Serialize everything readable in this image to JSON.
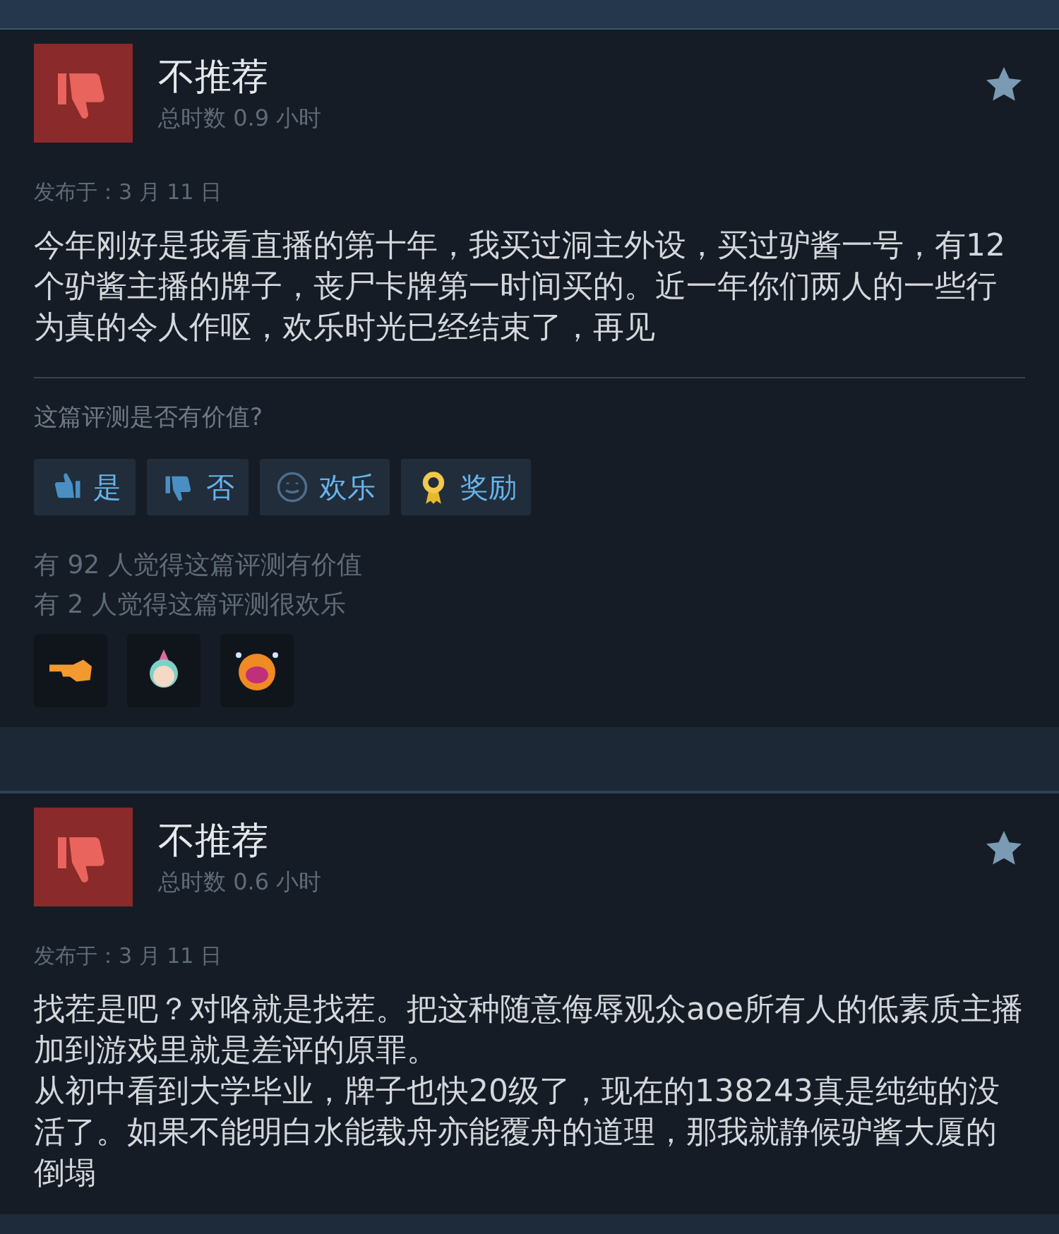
{
  "reviews": [
    {
      "verdict": "不推荐",
      "hours": "总时数 0.9 小时",
      "posted": "发布于：3 月 11 日",
      "paragraphs": [
        "今年刚好是我看直播的第十年，我买过洞主外设，买过驴酱一号，有12个驴酱主播的牌子，丧尸卡牌第一时间买的。近一年你们两人的一些行为真的令人作呕，欢乐时光已经结束了，再见"
      ],
      "helpful_prompt": "这篇评测是否有价值?",
      "buttons": [
        {
          "kind": "yes",
          "label": "是"
        },
        {
          "kind": "no",
          "label": "否"
        },
        {
          "kind": "funny",
          "label": "欢乐"
        },
        {
          "kind": "award",
          "label": "奖励"
        }
      ],
      "counts": [
        "有 92 人觉得这篇评测有价值",
        "有 2 人觉得这篇评测很欢乐"
      ],
      "awards": [
        {
          "kind": "hand"
        },
        {
          "kind": "figure"
        },
        {
          "kind": "laugh"
        }
      ]
    },
    {
      "verdict": "不推荐",
      "hours": "总时数 0.6 小时",
      "posted": "发布于：3 月 11 日",
      "paragraphs": [
        "找茬是吧？对咯就是找茬。把这种随意侮辱观众aoe所有人的低素质主播加到游戏里就是差评的原罪。",
        "从初中看到大学毕业，牌子也快20级了，现在的138243真是纯纯的没活了。如果不能明白水能载舟亦能覆舟的道理，那我就静候驴酱大厦的倒塌"
      ]
    }
  ]
}
